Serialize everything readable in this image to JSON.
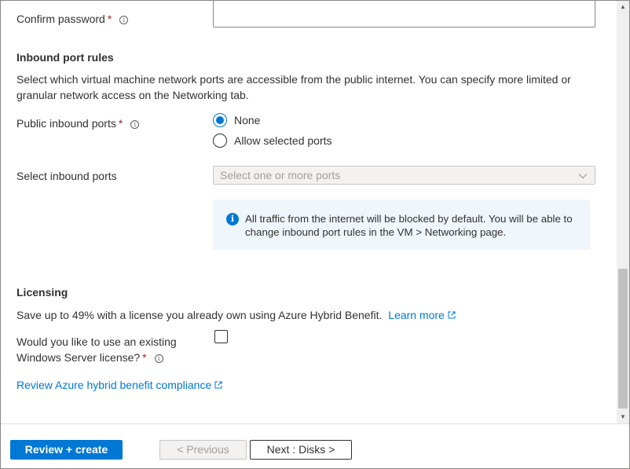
{
  "account": {
    "confirm_password_label": "Confirm password",
    "confirm_password_value": ""
  },
  "inbound": {
    "section_title": "Inbound port rules",
    "description": "Select which virtual machine network ports are accessible from the public internet. You can specify more limited or granular network access on the Networking tab.",
    "public_ports_label": "Public inbound ports",
    "options": [
      "None",
      "Allow selected ports"
    ],
    "selected_option": "None",
    "select_ports_label": "Select inbound ports",
    "select_ports_placeholder": "Select one or more ports",
    "info_text": "All traffic from the internet will be blocked by default. You will be able to change inbound port rules in the VM > Networking page."
  },
  "licensing": {
    "section_title": "Licensing",
    "description": "Save up to 49% with a license you already own using Azure Hybrid Benefit.",
    "learn_more": "Learn more",
    "existing_license_label_line1": "Would you like to use an existing",
    "existing_license_label_line2": "Windows Server license?",
    "existing_license_checked": false,
    "compliance_link": "Review Azure hybrid benefit compliance"
  },
  "footer": {
    "review_create": "Review + create",
    "previous": "< Previous",
    "next": "Next : Disks >"
  },
  "required_marker": "*",
  "info_glyph": "i",
  "colors": {
    "accent": "#0078d4",
    "required": "#a4262c",
    "info_background": "#eff6fc"
  }
}
